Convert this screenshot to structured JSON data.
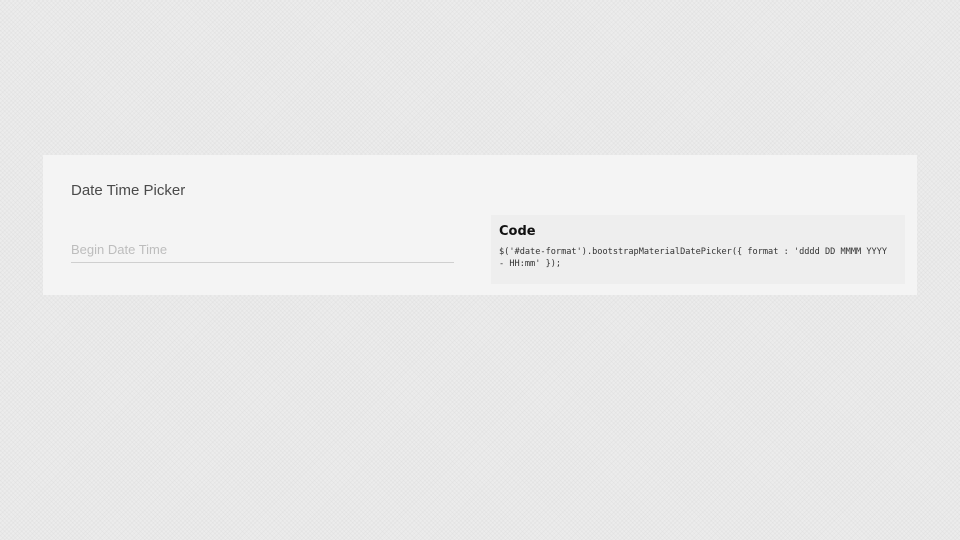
{
  "card": {
    "title": "Date Time Picker"
  },
  "date_input": {
    "placeholder": "Begin Date Time",
    "value": ""
  },
  "code_panel": {
    "title": "Code",
    "snippet": "$('#date-format').bootstrapMaterialDatePicker({ format : 'dddd DD MMMM YYYY - HH:mm' });"
  }
}
